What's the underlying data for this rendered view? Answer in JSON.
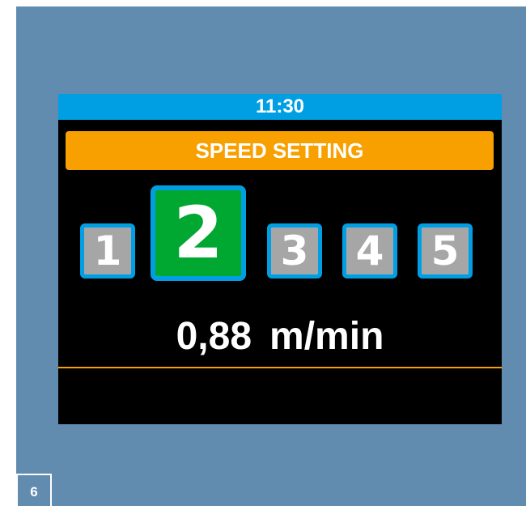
{
  "status_bar": {
    "time": "11:30"
  },
  "header": {
    "title": "SPEED SETTING"
  },
  "speed_selector": {
    "selected": "2",
    "options": [
      {
        "label": "1",
        "active": false
      },
      {
        "label": "2",
        "active": true
      },
      {
        "label": "3",
        "active": false
      },
      {
        "label": "4",
        "active": false
      },
      {
        "label": "5",
        "active": false
      }
    ]
  },
  "readout": {
    "value": "0,88",
    "unit": "m/min"
  },
  "page": {
    "number": "6"
  },
  "colors": {
    "page_background": "#628bb0",
    "screen_background": "#000000",
    "status_bar": "#009fe3",
    "title_bar": "#f7a000",
    "active_speed": "#00a832",
    "inactive_speed": "#a6a6a6",
    "button_border": "#009fe3",
    "divider": "#f7a000"
  }
}
